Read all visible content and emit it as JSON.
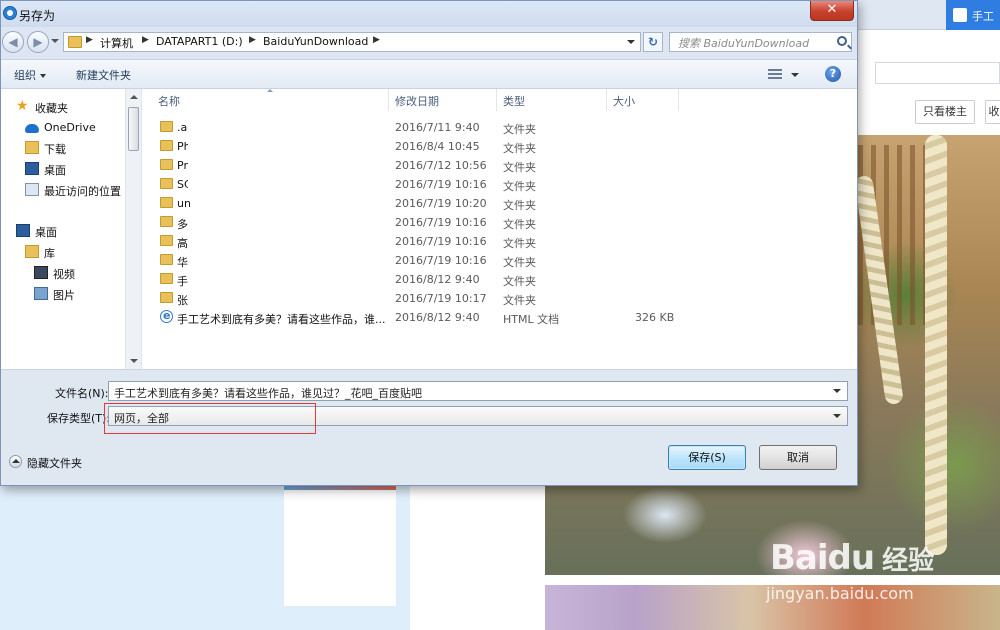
{
  "dialog": {
    "title": "另存为",
    "close_glyph": "✕"
  },
  "address": {
    "crumbs": [
      "计算机",
      "DATAPART1 (D:)",
      "BaiduYunDownload"
    ],
    "search_placeholder": "搜索 BaiduYunDownload"
  },
  "toolbar": {
    "organize": "组织",
    "new_folder": "新建文件夹",
    "help": "?"
  },
  "nav_pane": {
    "favorites": {
      "label": "收藏夹",
      "icon": "star-icon"
    },
    "favorite_items": [
      {
        "label": "OneDrive",
        "icon": "onedrive-icon"
      },
      {
        "label": "下载",
        "icon": "downloads-folder-icon"
      },
      {
        "label": "桌面",
        "icon": "desktop-icon"
      },
      {
        "label": "最近访问的位置",
        "icon": "recent-places-icon"
      }
    ],
    "desktop": {
      "label": "桌面",
      "icon": "desktop-icon"
    },
    "library": {
      "label": "库",
      "icon": "library-icon"
    },
    "library_items": [
      {
        "label": "视频",
        "icon": "video-icon"
      },
      {
        "label": "图片",
        "icon": "pictures-icon"
      }
    ]
  },
  "columns": {
    "name": "名称",
    "date": "修改日期",
    "type": "类型",
    "size": "大小"
  },
  "files": [
    {
      "name": ".ac",
      "date": "2016/7/11 9:40",
      "type": "文件夹",
      "size": "",
      "icon": "folder-icon"
    },
    {
      "name": "Ph",
      "date": "2016/8/4 10:45",
      "type": "文件夹",
      "size": "",
      "icon": "folder-icon"
    },
    {
      "name": "Pro",
      "date": "2016/7/12 10:56",
      "type": "文件夹",
      "size": "",
      "icon": "folder-icon"
    },
    {
      "name": "SC",
      "date": "2016/7/19 10:16",
      "type": "文件夹",
      "size": "",
      "icon": "folder-icon"
    },
    {
      "name": "un",
      "date": "2016/7/19 10:20",
      "type": "文件夹",
      "size": "",
      "icon": "folder-icon"
    },
    {
      "name": "多",
      "date": "2016/7/19 10:16",
      "type": "文件夹",
      "size": "",
      "icon": "folder-icon"
    },
    {
      "name": "高",
      "date": "2016/7/19 10:16",
      "type": "文件夹",
      "size": "",
      "icon": "folder-icon"
    },
    {
      "name": "华",
      "date": "2016/7/19 10:16",
      "type": "文件夹",
      "size": "",
      "icon": "folder-icon"
    },
    {
      "name": "手",
      "date": "2016/8/12 9:40",
      "type": "文件夹",
      "size": "",
      "icon": "folder-icon"
    },
    {
      "name": "张",
      "date": "2016/7/19 10:17",
      "type": "文件夹",
      "size": "",
      "icon": "folder-icon"
    },
    {
      "name": "手工艺术到底有多美？请看这些作品，谁...",
      "date": "2016/8/12 9:40",
      "type": "HTML 文档",
      "size": "326 KB",
      "icon": "ie-html-icon"
    }
  ],
  "form": {
    "filename_label": "文件名(N):",
    "filename_value": "手工艺术到底有多美？请看这些作品，谁见过？_花吧_百度贴吧",
    "filetype_label": "保存类型(T):",
    "filetype_value": "网页，全部",
    "hide_folders": "隐藏文件夹",
    "save": "保存(S)",
    "cancel": "取消"
  },
  "background": {
    "tab_right": "手工",
    "btn_only_op": "只看楼主",
    "btn_partial": "收",
    "watermark_brand": "Baidu",
    "watermark_cn": "经验",
    "watermark_url": "jingyan.baidu.com",
    "accent": "#2f7de1"
  }
}
